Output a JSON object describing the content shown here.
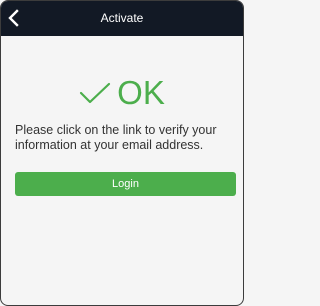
{
  "header": {
    "title": "Activate",
    "back_icon": "chevron-left-icon"
  },
  "status": {
    "icon": "checkmark-icon",
    "text": "OK"
  },
  "message": "Please click on the link to verify your information at your email address.",
  "login_button": {
    "label": "Login"
  },
  "colors": {
    "header_bg": "#121925",
    "accent": "#4cae4c",
    "text": "#333333",
    "background": "#f5f5f5"
  }
}
